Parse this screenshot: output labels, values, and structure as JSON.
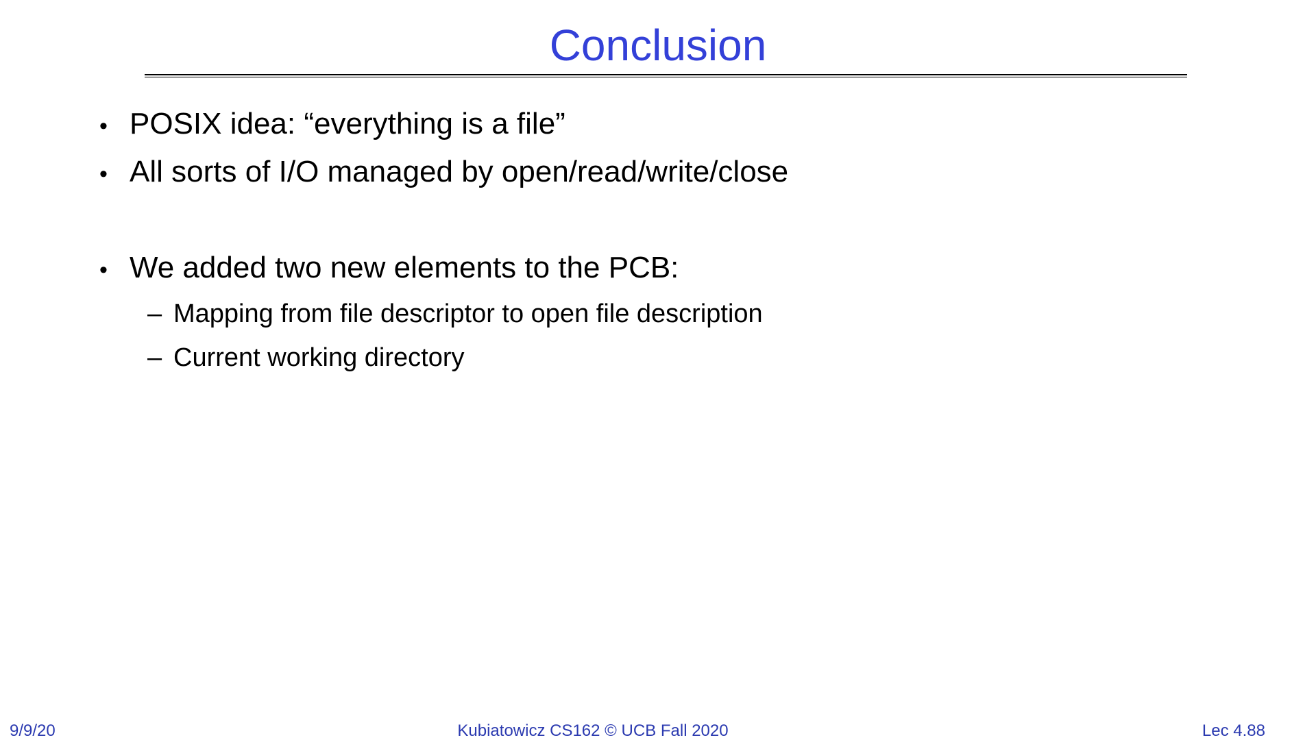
{
  "slide": {
    "title": "Conclusion",
    "bullets": [
      {
        "mark": "•",
        "text": "POSIX idea: “everything is a file”"
      },
      {
        "mark": "•",
        "text": "All sorts of I/O managed by open/read/write/close"
      },
      {
        "mark": "•",
        "text": "We added two new elements to the PCB:"
      }
    ],
    "sub_bullets": [
      {
        "mark": "–",
        "text": "Mapping from file descriptor to open file description"
      },
      {
        "mark": "–",
        "text": "Current working directory"
      }
    ]
  },
  "footer": {
    "date": "9/9/20",
    "center": "Kubiatowicz CS162 © UCB Fall 2020",
    "page": "Lec 4.88"
  },
  "colors": {
    "title": "#3340d8",
    "footer": "#2b3ab0",
    "text": "#000000"
  }
}
